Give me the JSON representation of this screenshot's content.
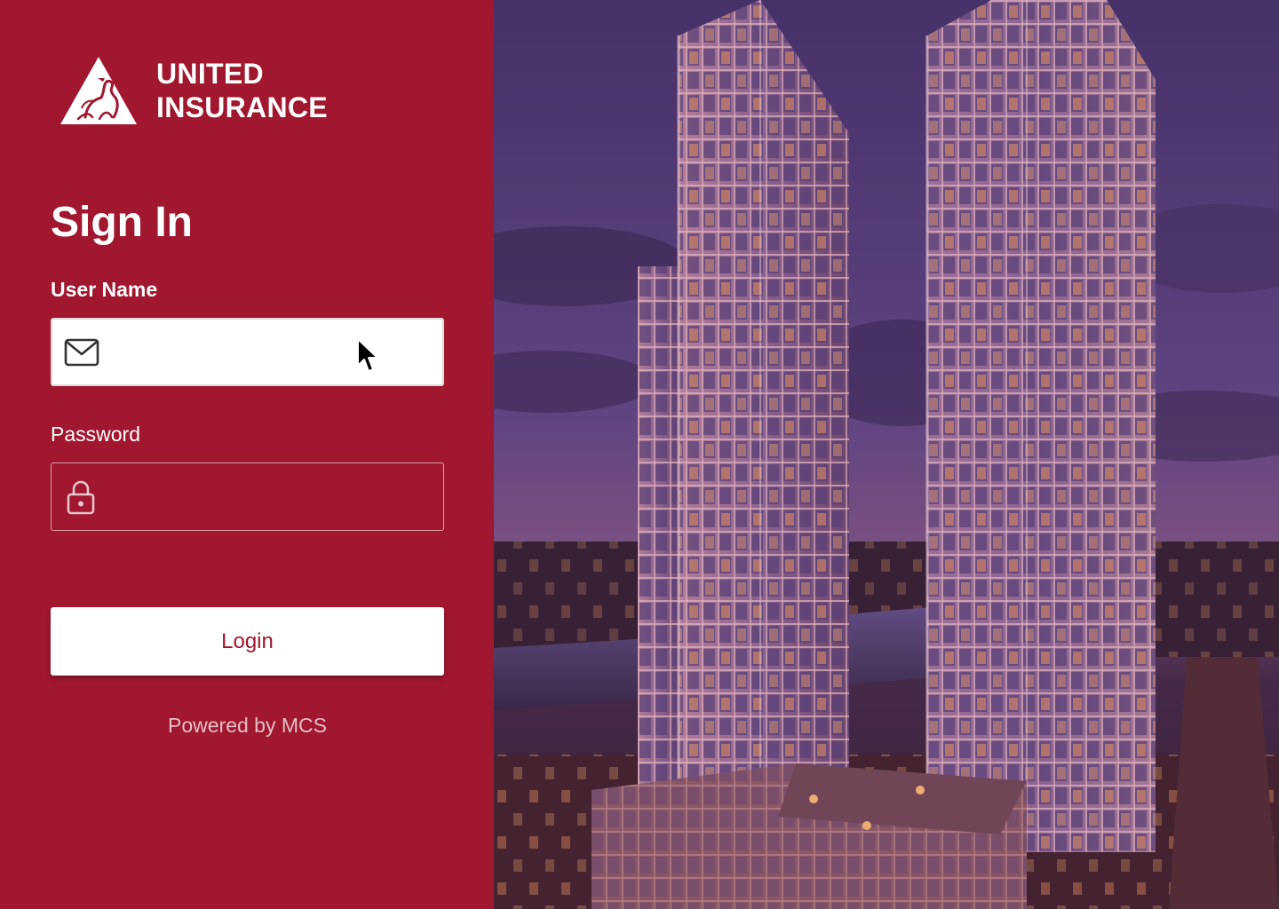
{
  "brand": {
    "line1": "UNITED",
    "line2": "INSURANCE",
    "logo_icon": "lion-triangle-logo-icon",
    "color": "#a0172f"
  },
  "form": {
    "title": "Sign In",
    "username": {
      "label": "User Name",
      "value": "",
      "placeholder": "",
      "icon": "mail-icon"
    },
    "password": {
      "label": "Password",
      "value": "",
      "placeholder": "",
      "icon": "lock-icon"
    },
    "login_label": "Login"
  },
  "footer": {
    "powered_by": "Powered by MCS"
  }
}
